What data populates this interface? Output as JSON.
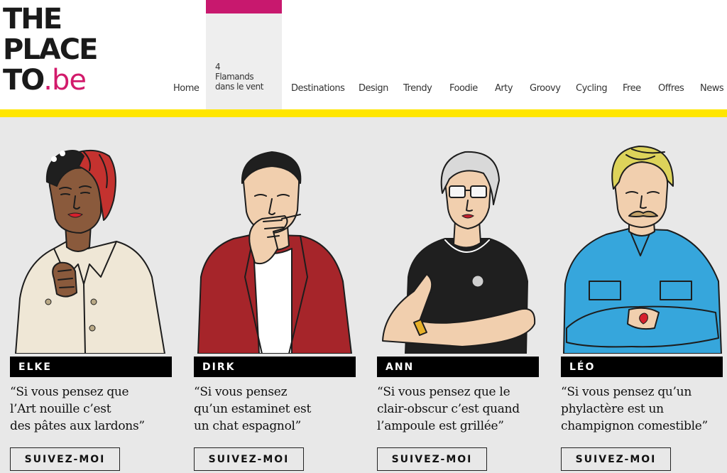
{
  "logo": {
    "line1": "THE",
    "line2": "PLACE",
    "line3_prefix": "TO",
    "line3_suffix": ".be"
  },
  "nav": {
    "home": "Home",
    "active_number": "4",
    "active_line1": "Flamands",
    "active_line2": "dans le vent",
    "destinations": "Destinations",
    "design": "Design",
    "trendy": "Trendy",
    "foodie": "Foodie",
    "arty": "Arty",
    "groovy": "Groovy",
    "cycling": "Cycling",
    "free": "Free",
    "offres": "Offres",
    "news": "News"
  },
  "colors": {
    "accent_pink": "#c8186e",
    "accent_yellow": "#ffe600",
    "background": "#e8e8e8"
  },
  "cards": [
    {
      "name": "ELKE",
      "quote_line1": "“Si vous pensez que",
      "quote_line2": "l’Art nouille c’est",
      "quote_line3": "des pâtes aux lardons”",
      "button": "SUIVEZ-MOI"
    },
    {
      "name": "DIRK",
      "quote_line1": "“Si vous pensez",
      "quote_line2": "qu’un estaminet est",
      "quote_line3": "un chat espagnol”",
      "button": "SUIVEZ-MOI"
    },
    {
      "name": "ANN",
      "quote_line1": "“Si vous pensez que le",
      "quote_line2": "clair-obscur c’est quand",
      "quote_line3": "l’ampoule est grillée”",
      "button": "SUIVEZ-MOI"
    },
    {
      "name": "LÉO",
      "quote_line1": "“Si vous pensez qu’un",
      "quote_line2": "phylactère est un",
      "quote_line3": "champignon comestible”",
      "button": "SUIVEZ-MOI"
    }
  ]
}
